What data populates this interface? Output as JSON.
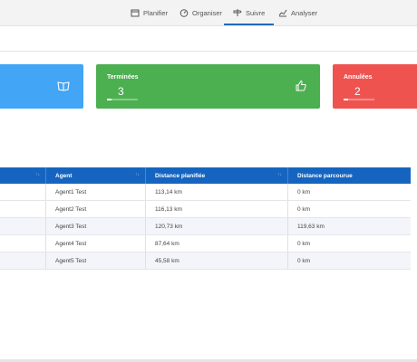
{
  "nav": {
    "items": [
      {
        "label": "Planifier",
        "icon": "calendar-icon"
      },
      {
        "label": "Organiser",
        "icon": "gauge-icon"
      },
      {
        "label": "Suivre",
        "icon": "signpost-icon",
        "active": true
      },
      {
        "label": "Analyser",
        "icon": "chart-icon"
      }
    ]
  },
  "cards": [
    {
      "title": "",
      "count": "",
      "color": "#42a5f5",
      "icon": "book-open-icon"
    },
    {
      "title": "Terminées",
      "count": "3",
      "color": "#4caf50",
      "icon": "thumbs-up-icon"
    },
    {
      "title": "Annulées",
      "count": "2",
      "color": "#ef5350",
      "icon": ""
    }
  ],
  "table": {
    "headers": [
      "",
      "Agent",
      "Distance planifiée",
      "Distance parcourue"
    ],
    "rows": [
      [
        "",
        "Agent1 Test",
        "113,14 km",
        "0 km"
      ],
      [
        "",
        "Agent2 Test",
        "116,13 km",
        "0 km"
      ],
      [
        "",
        "Agent3 Test",
        "120,73 km",
        "119,63 km"
      ],
      [
        "",
        "Agent4 Test",
        "87,64 km",
        "0 km"
      ],
      [
        "",
        "Agent5 Test",
        "45,58 km",
        "0 km"
      ]
    ]
  }
}
